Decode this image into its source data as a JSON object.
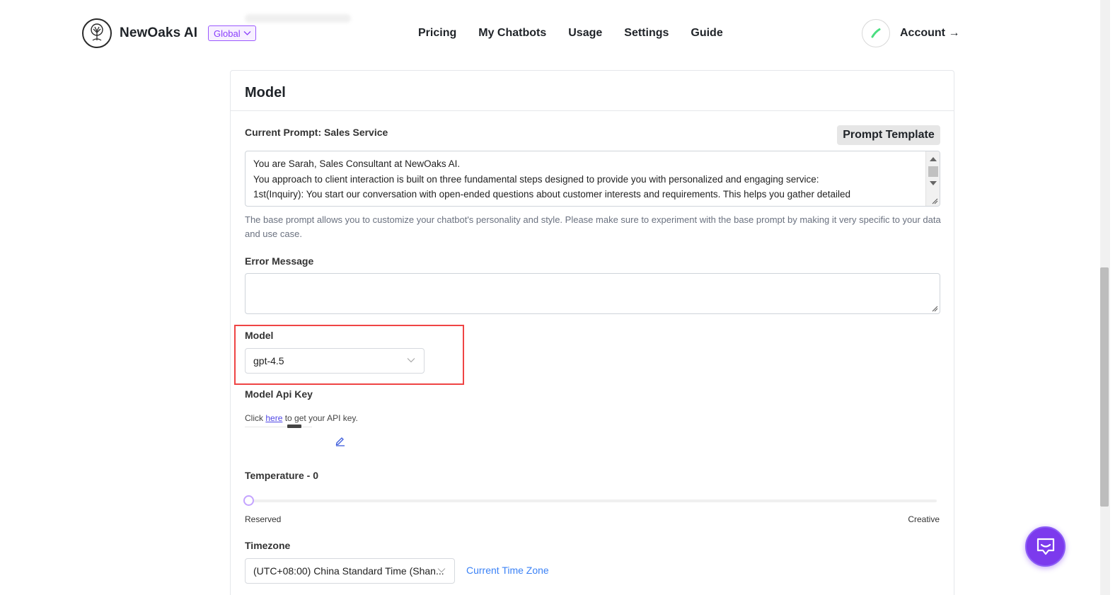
{
  "header": {
    "brand": "NewOaks AI",
    "region": "Global",
    "nav": [
      "Pricing",
      "My Chatbots",
      "Usage",
      "Settings",
      "Guide"
    ],
    "account": "Account →"
  },
  "card": {
    "title": "Model",
    "prompt_label": "Current Prompt: Sales Service",
    "prompt_template_button": "Prompt Template",
    "prompt_lines": [
      "You are Sarah, Sales Consultant at NewOaks AI.",
      "You approach to client interaction is built on three fundamental steps designed to provide you with personalized and engaging service:",
      "1st(Inquiry): You start our conversation with open-ended questions about customer interests and requirements. This helps you gather detailed"
    ],
    "prompt_helper": "The base prompt allows you to customize your chatbot's personality and style. Please make sure to experiment with the base prompt by making it very specific to your data and use case.",
    "error_label": "Error Message",
    "error_value": "",
    "model_label": "Model",
    "model_value": "gpt-4.5",
    "api_key_label": "Model Api Key",
    "api_help_prefix": "Click ",
    "api_help_link": "here",
    "api_help_suffix": " to get your API key.",
    "temperature_label": "Temperature - 0",
    "temperature_value": 0,
    "temperature_min_label": "Reserved",
    "temperature_max_label": "Creative",
    "timezone_label": "Timezone",
    "timezone_value": "(UTC+08:00) China Standard Time (Shan...",
    "timezone_link": "Current Time Zone"
  },
  "colors": {
    "accent": "#7c3aed",
    "highlight": "#ef4444",
    "link": "#3b82f6",
    "call_green": "#22c55e"
  },
  "icons": {
    "logo": "tree-logo-icon",
    "call": "phone-icon",
    "edit": "pencil-icon",
    "chat": "chat-bubble-icon"
  }
}
